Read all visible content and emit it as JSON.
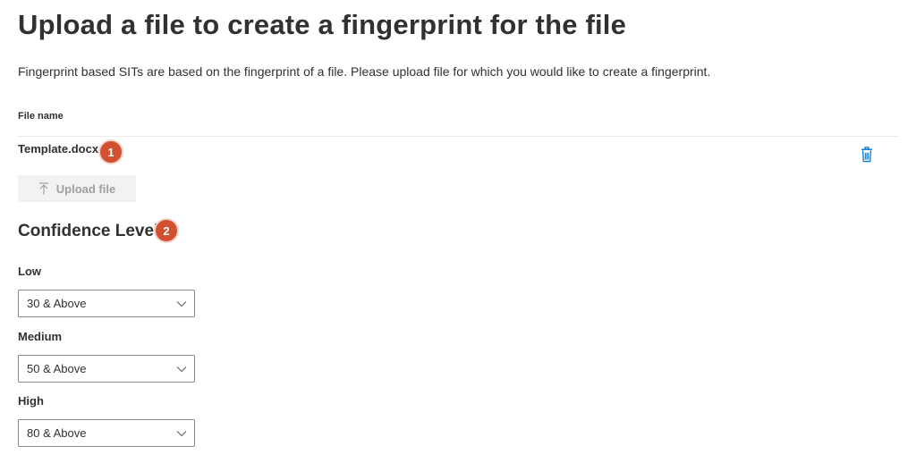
{
  "page": {
    "title": "Upload a file to create a fingerprint for the file",
    "description": "Fingerprint based SITs are based on the fingerprint of a file. Please upload file for which you would like to create a fingerprint."
  },
  "file_table": {
    "column_header": "File name",
    "rows": [
      {
        "file_name": "Template.docx",
        "delete_icon": "trash-icon"
      }
    ]
  },
  "upload": {
    "label": "Upload file",
    "icon": "upload-arrow-icon",
    "disabled": true
  },
  "confidence": {
    "title": "Confidence Level",
    "levels": [
      {
        "label": "Low",
        "selected": "30 & Above"
      },
      {
        "label": "Medium",
        "selected": "50 & Above"
      },
      {
        "label": "High",
        "selected": "80 & Above"
      }
    ]
  },
  "callouts": [
    "1",
    "2"
  ],
  "colors": {
    "accent": "#0078d4",
    "callout": "#d0502f",
    "text": "#323130",
    "disabled_text": "#a19f9d",
    "disabled_bg": "#f3f2f1",
    "border": "#8a8886"
  }
}
